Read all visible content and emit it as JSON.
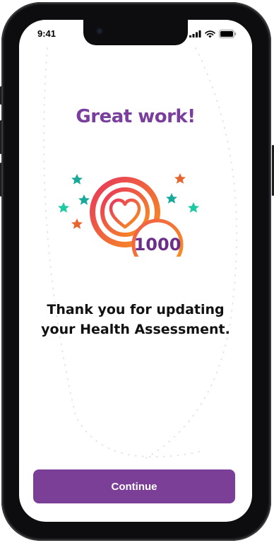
{
  "status_bar": {
    "time": "9:41"
  },
  "screen": {
    "title": "Great work!",
    "badge": {
      "points": "1000",
      "icon": "heart-icon"
    },
    "message_line1": "Thank you for updating",
    "message_line2": "your Health Assessment.",
    "continue_label": "Continue"
  },
  "colors": {
    "accent": "#7c3f98",
    "title": "#7a3f9c",
    "gradient_start": "#e8365d",
    "gradient_end": "#f7941d",
    "star_green": "#1cc9a0",
    "star_teal": "#17a99a",
    "star_orange": "#e8642e"
  }
}
